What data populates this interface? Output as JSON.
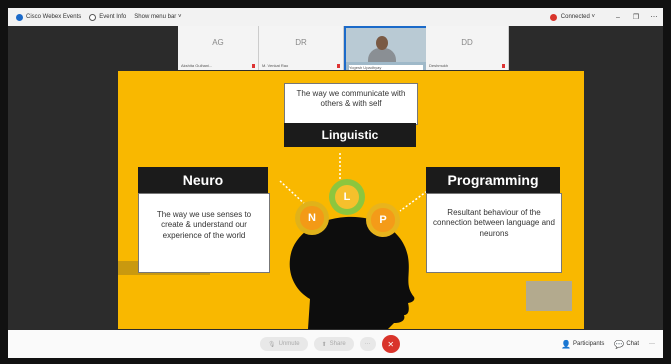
{
  "titlebar": {
    "app_name": "Cisco Webex Events",
    "event_info": "Event Info",
    "show_menu_bar": "Show menu bar ˅",
    "status": "Connected ˅",
    "minimize": "–",
    "restore": "❐",
    "close": "⋯"
  },
  "participants": [
    {
      "initials": "AG",
      "name": "Akshita Gulhani...",
      "active": false
    },
    {
      "initials": "DR",
      "name": "M. Venkat Rao",
      "active": false
    },
    {
      "initials": "",
      "name": "Yogesh Upadhyay",
      "active": true
    },
    {
      "initials": "DD",
      "name": "Deshmukh",
      "active": false
    }
  ],
  "slide": {
    "top_box_text": "The way we communicate with others & with self",
    "top_box_title": "Linguistic",
    "left_box_title": "Neuro",
    "left_box_text": "The way we use senses to create & understand our experience of the world",
    "right_box_title": "Programming",
    "right_box_text": "Resultant behaviour of the connection between language and neurons",
    "gears": [
      {
        "letter": "N",
        "color": "#e0b21a",
        "inner": "#f39a16"
      },
      {
        "letter": "L",
        "color": "#8cc63e",
        "inner": "#f6c02c"
      },
      {
        "letter": "P",
        "color": "#e8b41d",
        "inner": "#f49b18"
      }
    ]
  },
  "controls": {
    "unmute": "Unmute",
    "share": "Share",
    "more": "···",
    "end": "✕",
    "participants": "Participants",
    "chat": "Chat",
    "more_right": "···"
  }
}
